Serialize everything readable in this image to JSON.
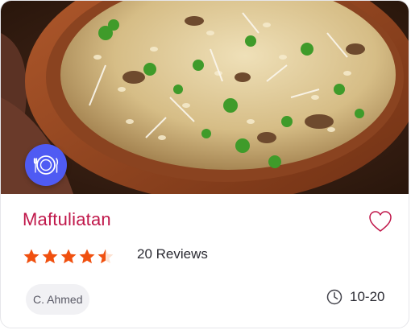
{
  "recipe": {
    "title": "Maftuliatan",
    "rating": 4.5,
    "rating_max": 5,
    "reviews_label": "20 Reviews",
    "author": "C. Ahmed",
    "time": "10-20",
    "category_icon": "plate-with-utensils-icon"
  },
  "colors": {
    "title": "#c0174a",
    "heart": "#c0174a",
    "star_filled": "#f0500f",
    "star_empty": "#fde2d2",
    "badge": "#4f5bf3"
  },
  "icons": {
    "favorite": "heart-outline-icon",
    "time": "clock-icon"
  }
}
